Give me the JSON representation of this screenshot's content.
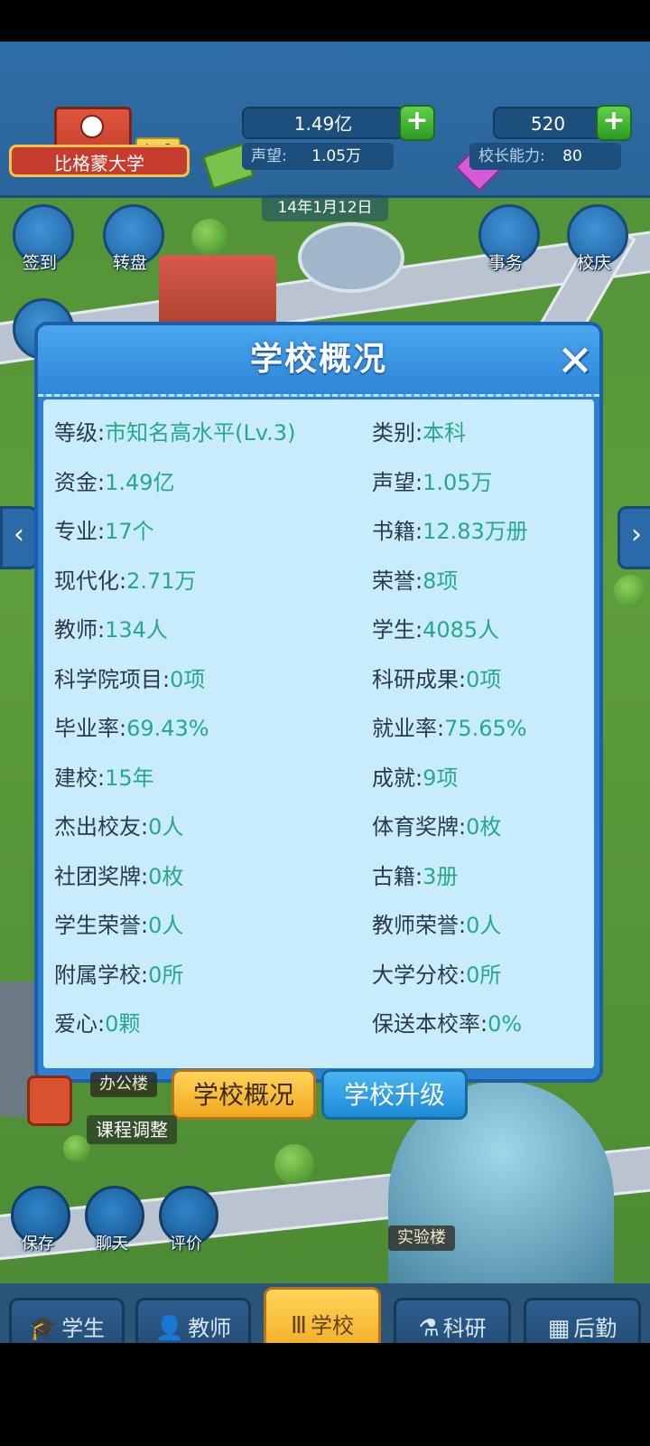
{
  "hud": {
    "school_name": "比格蒙大学",
    "level": "Lv.3",
    "money": "1.49亿",
    "reputation_label": "声望:",
    "reputation_value": "1.05万",
    "gems": "520",
    "principal_label": "校长能力:",
    "principal_value": "80",
    "date": "14年1月12日"
  },
  "side_buttons": {
    "checkin": "签到",
    "wheel": "转盘",
    "affairs": "事务",
    "anniversary": "校庆"
  },
  "modal": {
    "title": "学校概况",
    "close_icon": "close-icon",
    "rows": [
      {
        "lk": "等级:",
        "lv": "市知名高水平(Lv.3)",
        "rk": "类别:",
        "rv": "本科"
      },
      {
        "lk": "资金:",
        "lv": "1.49亿",
        "rk": "声望:",
        "rv": "1.05万"
      },
      {
        "lk": "专业:",
        "lv": "17个",
        "rk": "书籍:",
        "rv": "12.83万册"
      },
      {
        "lk": "现代化:",
        "lv": "2.71万",
        "rk": "荣誉:",
        "rv": "8项"
      },
      {
        "lk": "教师:",
        "lv": "134人",
        "rk": "学生:",
        "rv": "4085人"
      },
      {
        "lk": "科学院项目:",
        "lv": "0项",
        "rk": "科研成果:",
        "rv": "0项"
      },
      {
        "lk": "毕业率:",
        "lv": "69.43%",
        "rk": "就业率:",
        "rv": "75.65%"
      },
      {
        "lk": "建校:",
        "lv": "15年",
        "rk": "成就:",
        "rv": "9项"
      },
      {
        "lk": "杰出校友:",
        "lv": "0人",
        "rk": "体育奖牌:",
        "rv": "0枚"
      },
      {
        "lk": "社团奖牌:",
        "lv": "0枚",
        "rk": "古籍:",
        "rv": "3册"
      },
      {
        "lk": "学生荣誉:",
        "lv": "0人",
        "rk": "教师荣誉:",
        "rv": "0人"
      },
      {
        "lk": "附属学校:",
        "lv": "0所",
        "rk": "大学分校:",
        "rv": "0所"
      },
      {
        "lk": "爱心:",
        "lv": "0颗",
        "rk": "保送本校率:",
        "rv": "0%"
      }
    ]
  },
  "tabs": {
    "overview": "学校概况",
    "upgrade": "学校升级"
  },
  "map": {
    "office_label": "办公楼",
    "course_tip": "课程调整",
    "lab_label": "实验楼"
  },
  "quick": {
    "save": "保存",
    "chat": "聊天",
    "review": "评价"
  },
  "nav": {
    "students": "学生",
    "teachers": "教师",
    "school": "学校",
    "research": "科研",
    "logistics": "后勤"
  },
  "colors": {
    "value_green": "#28a88a",
    "modal_blue": "#2d7fcf",
    "active_tab": "#f0a71e"
  }
}
